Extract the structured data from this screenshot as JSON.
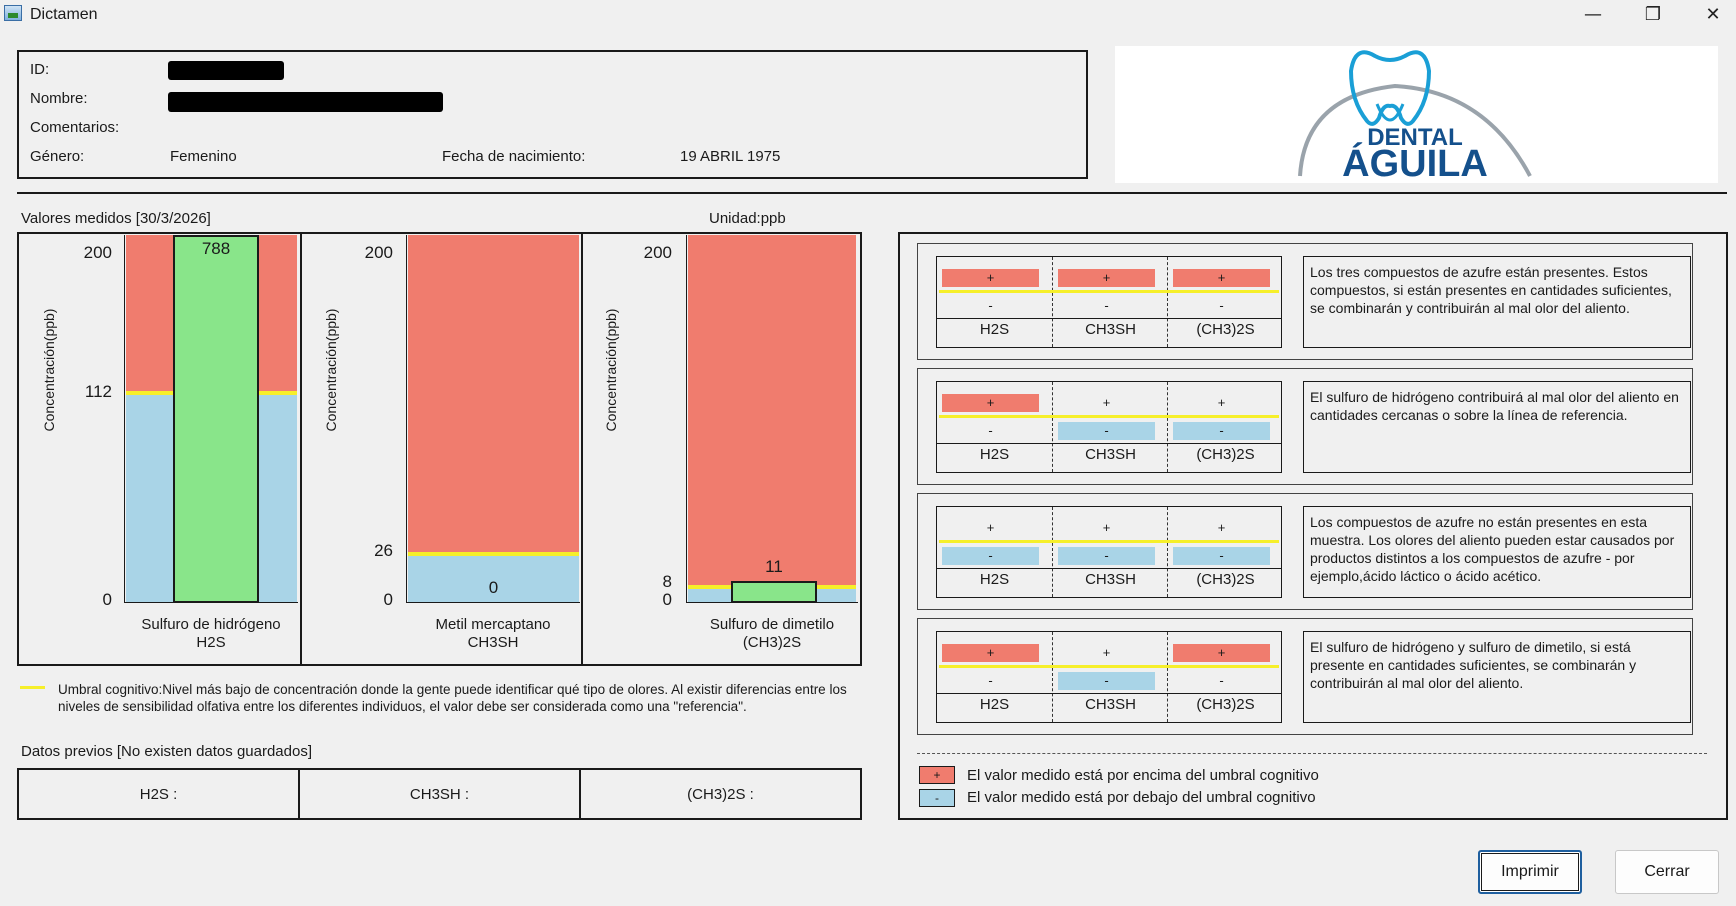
{
  "window": {
    "title": "Dictamen",
    "controls": {
      "minimize": "—",
      "restore": "❐",
      "close": "✕"
    }
  },
  "patient": {
    "id_label": "ID:",
    "name_label": "Nombre:",
    "comments_label": "Comentarios:",
    "gender_label": "Género:",
    "gender_value": "Femenino",
    "birth_label": "Fecha de nacimiento:",
    "birth_value": "19 ABRIL 1975"
  },
  "logo": {
    "line1": "DENTAL",
    "line2": "ÁGUILA",
    "colors": {
      "tooth": "#1a9fd6",
      "text": "#14508c",
      "arc": "#9aa3ab"
    }
  },
  "measured": {
    "title": "Valores medidos [30/3/2026]",
    "unit": "Unidad:ppb"
  },
  "colors": {
    "above": "#f07c6e",
    "below": "#a9d4e7",
    "threshold": "#f6ef2a",
    "measured": "#89e58a"
  },
  "charts": [
    {
      "ylabel": "Concentración(ppb)",
      "ticks": [
        "200",
        "112",
        "0"
      ],
      "value_label": "788",
      "name": "Sulfuro de hidrógeno",
      "formula": "H2S",
      "threshold": 112,
      "value": 788,
      "ymax": 200
    },
    {
      "ylabel": "Concentración(ppb)",
      "ticks": [
        "200",
        "26",
        "0"
      ],
      "value_label": "0",
      "name": "Metil mercaptano",
      "formula": "CH3SH",
      "threshold": 26,
      "value": 0,
      "ymax": 200
    },
    {
      "ylabel": "Concentración(ppb)",
      "ticks": [
        "200",
        "8",
        "0"
      ],
      "value_label": "11",
      "name": "Sulfuro de dimetilo",
      "formula": "(CH3)2S",
      "threshold": 8,
      "value": 11,
      "ymax": 200
    }
  ],
  "umbral_text": "Umbral cognitivo:Nivel más bajo de concentración donde la gente puede identificar qué tipo de olores. Al existir diferencias entre los niveles de sensibilidad olfativa entre los diferentes individuos, el valor debe ser considerada como una \"referencia\".",
  "previous": {
    "title": "Datos previos [No existen datos guardados]",
    "cells": [
      "H2S :",
      "CH3SH :",
      "(CH3)2S :"
    ]
  },
  "compounds": [
    "H2S",
    "CH3SH",
    "(CH3)2S"
  ],
  "symbols": {
    "plus": "+",
    "minus": "-"
  },
  "cases": [
    {
      "pattern": [
        "+",
        "+",
        "+"
      ],
      "description": "Los tres compuestos de azufre están presentes. Estos compuestos, si están presentes en cantidades suficientes, se combinarán y contribuirán al mal olor del aliento."
    },
    {
      "pattern": [
        "+",
        "-",
        "-"
      ],
      "description": "El sulfuro de hidrógeno contribuirá al mal olor del aliento en cantidades cercanas o sobre la línea de referencia."
    },
    {
      "pattern": [
        "-",
        "-",
        "-"
      ],
      "description": "Los compuestos de azufre no están presentes en esta muestra. Los olores del aliento pueden estar causados por productos distintos a los compuestos de azufre - por ejemplo,ácido láctico o ácido acético."
    },
    {
      "pattern": [
        "+",
        "-",
        "+"
      ],
      "description": "El sulfuro de hidrógeno y sulfuro de dimetilo, si está presente en cantidades suficientes, se combinarán y contribuirán al mal olor del aliento."
    }
  ],
  "legend": {
    "above": "El valor medido está por encima del umbral cognitivo",
    "below": "El valor medido está por debajo del umbral cognitivo"
  },
  "buttons": {
    "print": "Imprimir",
    "close": "Cerrar"
  }
}
